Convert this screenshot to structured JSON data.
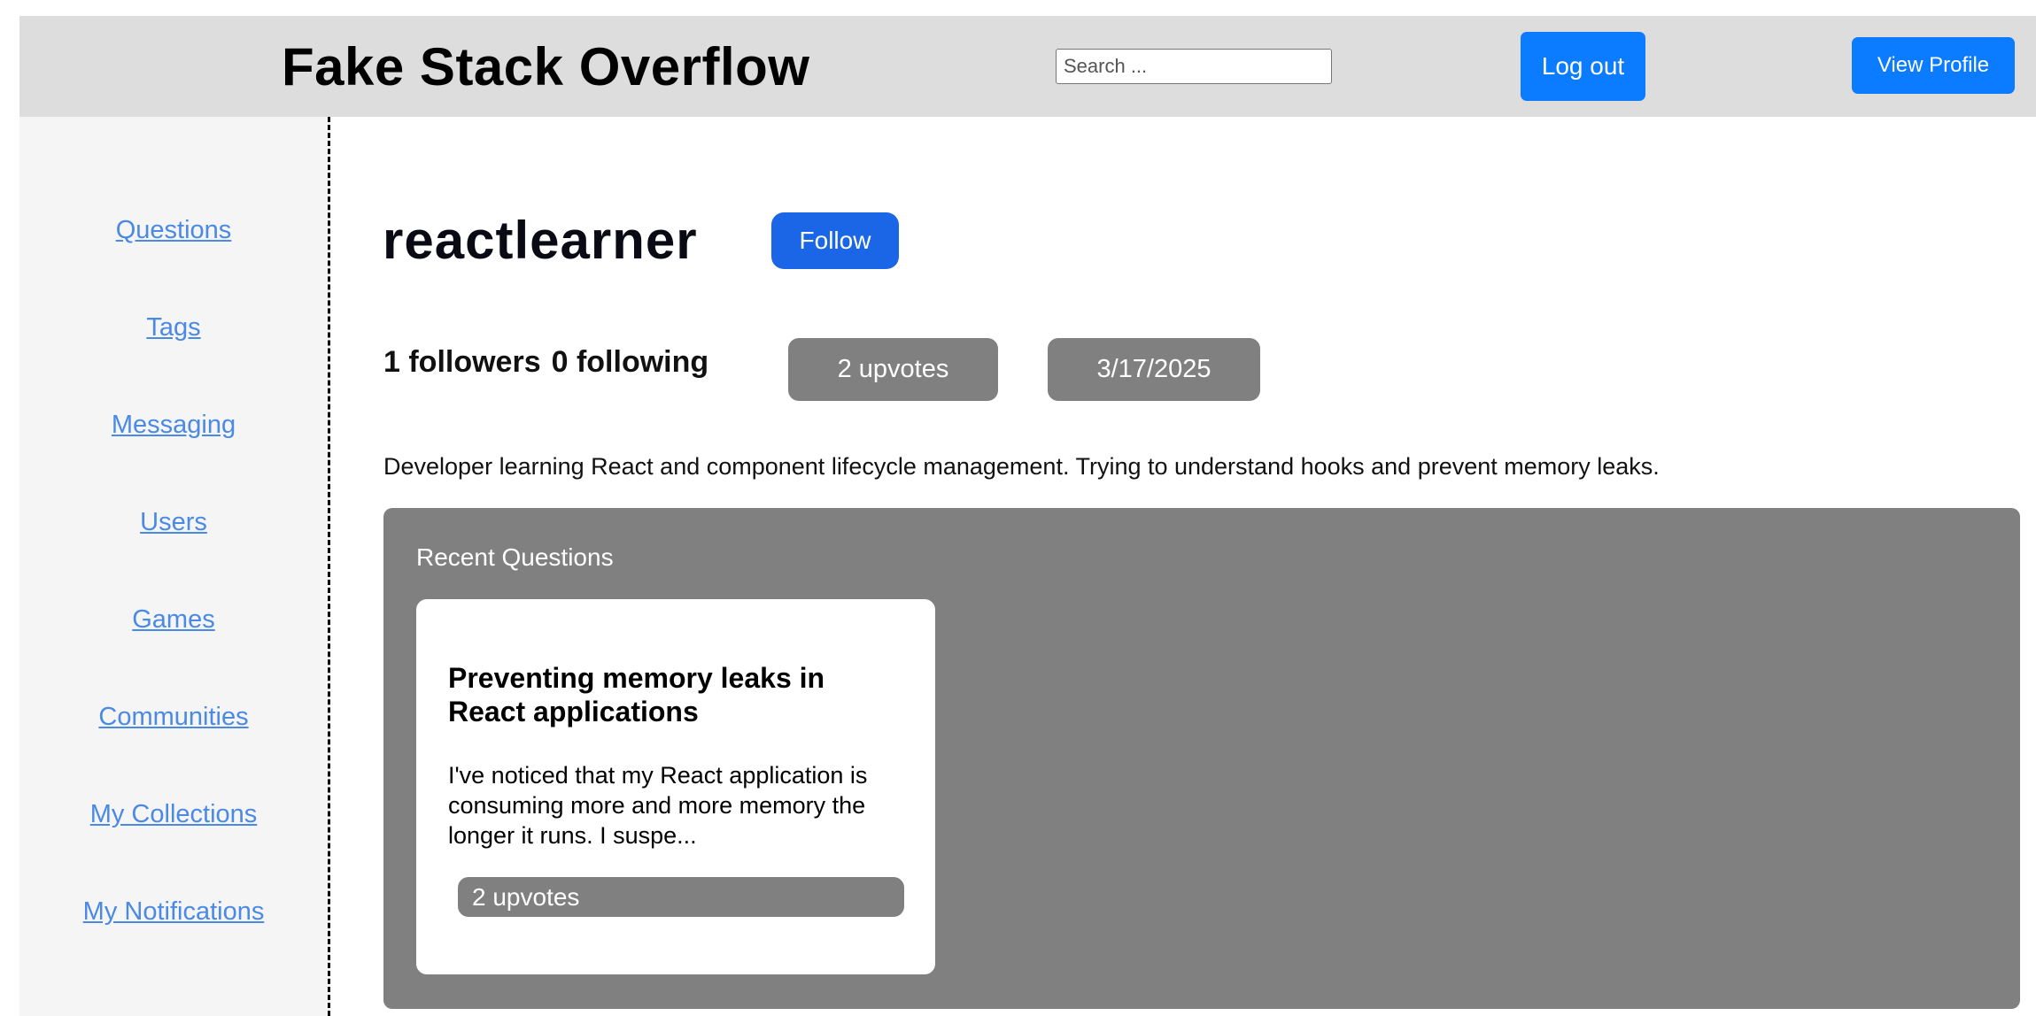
{
  "header": {
    "title": "Fake Stack Overflow",
    "search_placeholder": "Search ...",
    "logout_label": "Log out",
    "view_profile_label": "View Profile"
  },
  "sidebar": {
    "items": [
      {
        "label": "Questions"
      },
      {
        "label": "Tags"
      },
      {
        "label": "Messaging"
      },
      {
        "label": "Users"
      },
      {
        "label": "Games"
      },
      {
        "label": "Communities"
      },
      {
        "label": "My Collections"
      },
      {
        "label": "My Notifications"
      }
    ]
  },
  "profile": {
    "username": "reactlearner",
    "follow_label": "Follow",
    "followers": "1 followers",
    "following": "0 following",
    "upvotes": "2 upvotes",
    "joined": "3/17/2025",
    "bio": "Developer learning React and component lifecycle management. Trying to understand hooks and prevent memory leaks."
  },
  "recent_questions": {
    "heading": "Recent Questions",
    "items": [
      {
        "title": "Preventing memory leaks in React applications",
        "snippet": "I've noticed that my React application is consuming more and more memory the longer it runs. I suspe...",
        "upvotes": "2 upvotes"
      }
    ]
  },
  "colors": {
    "header_bg": "#dddddd",
    "primary_blue": "#0b7bff",
    "link_blue": "#4a89e6",
    "panel_grey": "#808080"
  }
}
